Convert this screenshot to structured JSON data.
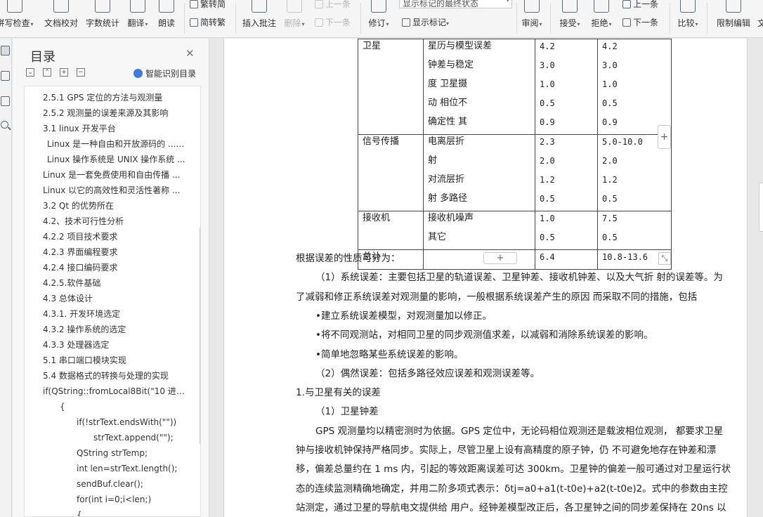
{
  "ribbon": {
    "buttons": [
      {
        "label": "拼写检查",
        "arrow": true
      },
      {
        "label": "文档校对",
        "arrow": false
      },
      {
        "label": "字数统计",
        "arrow": false
      },
      {
        "label": "翻译",
        "arrow": true
      },
      {
        "label": "朗读",
        "arrow": false
      },
      {
        "label": "插入批注",
        "arrow": false
      },
      {
        "label": "删除",
        "arrow": true
      },
      {
        "label": "修订",
        "arrow": true
      },
      {
        "label": "审阅",
        "arrow": true
      },
      {
        "label": "接受",
        "arrow": true
      },
      {
        "label": "拒绝",
        "arrow": true
      },
      {
        "label": "比较",
        "arrow": true
      },
      {
        "label": "限制编辑",
        "arrow": false
      },
      {
        "label": "文",
        "arrow": false
      }
    ],
    "small": {
      "trad": "繁转简",
      "simp": "简转繁",
      "prev_comment": "上一条",
      "next_comment": "下一条",
      "show_markup": "显示标记",
      "prev_change": "上一条",
      "next_change": "下一条"
    },
    "markup_combo": "显示标记的最终状态"
  },
  "toc": {
    "title": "目录",
    "smart": "智能识别目录",
    "items": [
      "2.5.1 GPS 定位的方法与观测量",
      "2.5.2 观测量的误差来源及其影响",
      "3.1 linux 开发平台",
      "Linux 是一种自由和开放源码的 ... ...",
      "Linux 操作系统是 UNIX 操作系统 ...",
      "Linux 是一套免费使用和自由传播 ...",
      "Linux 以它的高效性和灵活性著称 ...",
      "3.2 Qt 的优势所在",
      "4.2、技术可行性分析",
      "4.2.2 项目技术要求",
      "4.2.3 界面编程要求",
      "4.2.4 接口编码要求",
      "4.2.5.软件基础",
      "4.3 总体设计",
      "4.3.1. 开发环境选定",
      "4.3.2 操作系统的选定",
      "4.3.3 处理器选定",
      "5.1 串口端口模块实现",
      "5.4 数据格式的转换与处理的实现",
      "if(QString::fromLocal8Bit(\"10 进 ...",
      "{",
      "if(!strText.endsWith(\"\"))",
      "strText.append(\"\");",
      "QString strTemp;",
      "int len=strText.length();",
      "sendBuf.clear();",
      "for(int i=0;i<len;)",
      "{"
    ]
  },
  "table": {
    "rows": [
      {
        "source": "卫星",
        "items": [
          "星历与模型误差",
          "钟差与稳定",
          "度 卫星摄",
          "动 相位不",
          "确定性 其"
        ],
        "v1": [
          "4.2",
          "3.0",
          "1.0",
          "0.5",
          "0.9"
        ],
        "v2": [
          "4.2",
          "3.0",
          "1.0",
          "0.5",
          "0.9"
        ]
      },
      {
        "source": "信号传播",
        "items": [
          "电离层折",
          "射",
          "对流层折",
          "射 多路径"
        ],
        "v1": [
          "2.3",
          "2.0",
          "1.2",
          "0.5"
        ],
        "v2": [
          "5.0-10.0",
          "2.0",
          "1.2",
          "0.5"
        ]
      },
      {
        "source": "接收机",
        "items": [
          "接收机噪声",
          "其它"
        ],
        "v1": [
          "1.0",
          "0.5"
        ],
        "v2": [
          "7.5",
          "0.5"
        ]
      },
      {
        "source": "总计",
        "items": [
          ""
        ],
        "v1": [
          "6.4"
        ],
        "v2": [
          "10.8-13.6"
        ]
      }
    ]
  },
  "paragraphs": [
    "根据误差的性质可分为：",
    "（1）系统误差：主要包括卫星的轨道误差、卫星钟差、接收机钟差、以及大气折 射的误差等。为",
    "了减弱和修正系统误差对观测量的影响，一般根据系统误差产生的原因 而采取不同的措施，包括",
    "•建立系统误差模型，对观测量加以修正。",
    "•将不同观测站，对相同卫星的同步观测值求差，以减弱和消除系统误差的影响。",
    "•简单地忽略某些系统误差的影响。",
    "（2）偶然误差：包括多路径效应误差和观测误差等。",
    "1.与卫星有关的误差",
    "（1）卫星钟差",
    "GPS 观测量均以精密测时为依据。GPS 定位中，无论码相位观测还是载波相位观测， 都要求卫星",
    "钟与接收机钟保持严格同步。实际上，尽管卫星上设有高精度的原子钟，仍 不可避免地存在钟差和漂",
    "移，偏差总量约在 1 ms 内，引起的等效距离误差可达 300km。卫星钟的偏差一般可通过对卫星运行状",
    "态的连续监测精确地确定，并用二阶多项式表示：δtj=a0+a1(t-t0e)+a2(t-t0e)2。式中的参数由主控",
    "站测定，通过卫星的导航电文提供给 用户。经钟差模型改正后，各卫星钟之间的同步差保持在 20ns 以"
  ]
}
